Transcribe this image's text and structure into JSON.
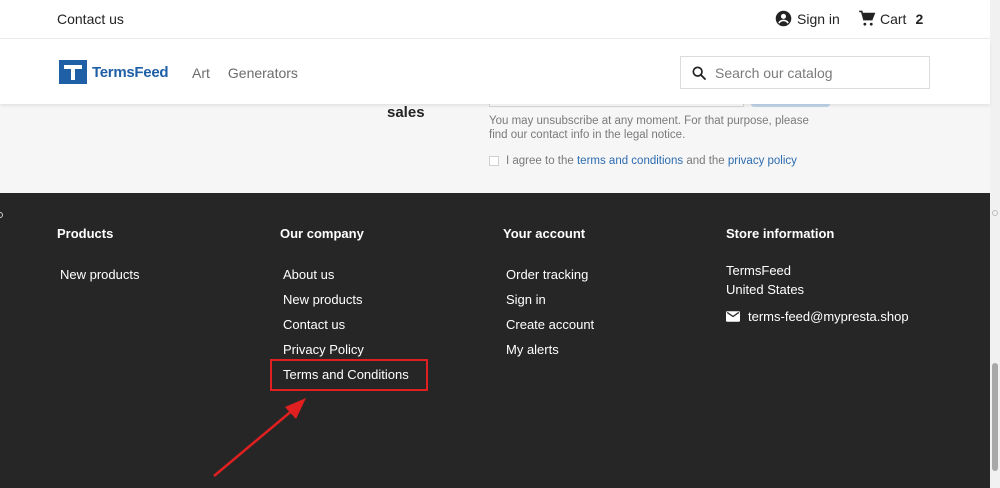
{
  "topbar": {
    "contact_label": "Contact us",
    "signin_label": "Sign in",
    "cart_label": "Cart",
    "cart_count": "2"
  },
  "header": {
    "logo_text": "TermsFeed",
    "nav": [
      "Art",
      "Generators"
    ],
    "search_placeholder": "Search our catalog"
  },
  "newsletter": {
    "title_fragment": "sales",
    "note": "You may unsubscribe at any moment. For that purpose, please find our contact info in the legal notice.",
    "agree_prefix": "I agree to the",
    "terms_link": "terms and conditions",
    "agree_middle": "and the",
    "privacy_link": "privacy policy"
  },
  "footer": {
    "products": {
      "title": "Products",
      "items": [
        "New products"
      ]
    },
    "company": {
      "title": "Our company",
      "items": [
        "About us",
        "New products",
        "Contact us",
        "Privacy Policy",
        "Terms and Conditions"
      ]
    },
    "account": {
      "title": "Your account",
      "items": [
        "Order tracking",
        "Sign in",
        "Create account",
        "My alerts"
      ]
    },
    "store": {
      "title": "Store information",
      "lines": [
        "TermsFeed",
        "United States"
      ],
      "email": "terms-feed@mypresta.shop"
    }
  },
  "colors": {
    "brand": "#1f5fa6",
    "footer_bg": "#262626",
    "link": "#2c6bb0",
    "highlight": "#e02020"
  }
}
